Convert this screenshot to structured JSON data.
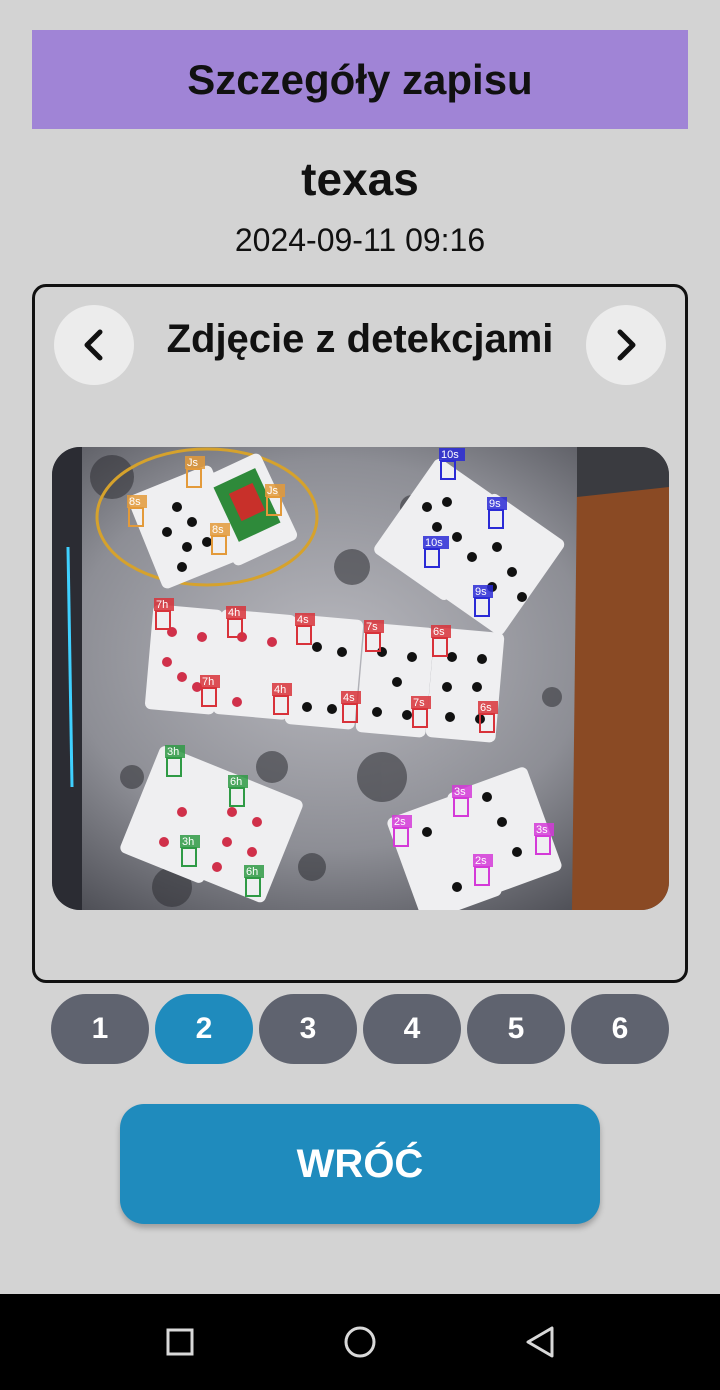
{
  "header": {
    "title": "Szczegóły zapisu"
  },
  "record": {
    "name": "texas",
    "datetime": "2024-09-11 09:16"
  },
  "viewer": {
    "title": "Zdjęcie z detekcjami",
    "prev_icon": "chevron-left-icon",
    "next_icon": "chevron-right-icon",
    "detections": [
      "Js",
      "8s",
      "8s",
      "Js",
      "10s",
      "9s",
      "10s",
      "9s",
      "7h",
      "4h",
      "4s",
      "7s",
      "6s",
      "7h",
      "4h",
      "4s",
      "7s",
      "6s",
      "3h",
      "6h",
      "3h",
      "6h",
      "3s",
      "2s",
      "3s",
      "2s"
    ]
  },
  "pagination": {
    "pages": [
      "1",
      "2",
      "3",
      "4",
      "5",
      "6"
    ],
    "selected": "2"
  },
  "back_button": {
    "label": "WRÓĆ"
  },
  "system_nav": {
    "icons": [
      "square-recent-icon",
      "circle-home-icon",
      "triangle-back-icon"
    ]
  },
  "colors": {
    "header_bg": "#a084d6",
    "accent": "#1f8bbd",
    "page_btn": "#5f636f",
    "background": "#d3d3d3"
  }
}
